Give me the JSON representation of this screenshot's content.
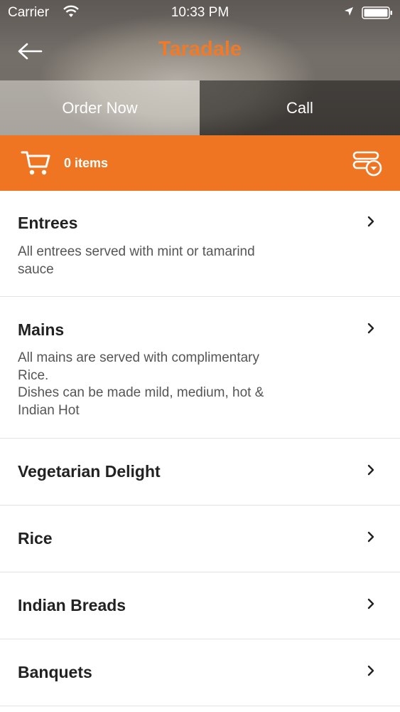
{
  "status_bar": {
    "carrier": "Carrier",
    "time": "10:33 PM",
    "icons": [
      "wifi-icon",
      "location-arrow-icon",
      "battery-icon"
    ]
  },
  "nav": {
    "back_icon": "back-arrow-icon",
    "title": "Taradale"
  },
  "tabs": [
    {
      "label": "Order Now",
      "selected": true
    },
    {
      "label": "Call",
      "selected": false
    }
  ],
  "cart": {
    "icon": "cart-icon",
    "count_label": "0 items",
    "filter_icon": "filter-icon"
  },
  "menu": {
    "items": [
      {
        "title": "Entrees",
        "description": "All entrees served with mint or tamarind\nsauce"
      },
      {
        "title": "Mains",
        "description": "All mains are served with complimentary\nRice.\nDishes can be made mild, medium, hot &\nIndian Hot"
      },
      {
        "title": "Vegetarian Delight",
        "description": ""
      },
      {
        "title": "Rice",
        "description": ""
      },
      {
        "title": "Indian Breads",
        "description": ""
      },
      {
        "title": "Banquets",
        "description": ""
      }
    ]
  },
  "colors": {
    "accent": "#f07522",
    "title_orange": "#f07a28",
    "text_dark": "#222222",
    "text_muted": "#555555",
    "divider": "#e2e2e2"
  }
}
